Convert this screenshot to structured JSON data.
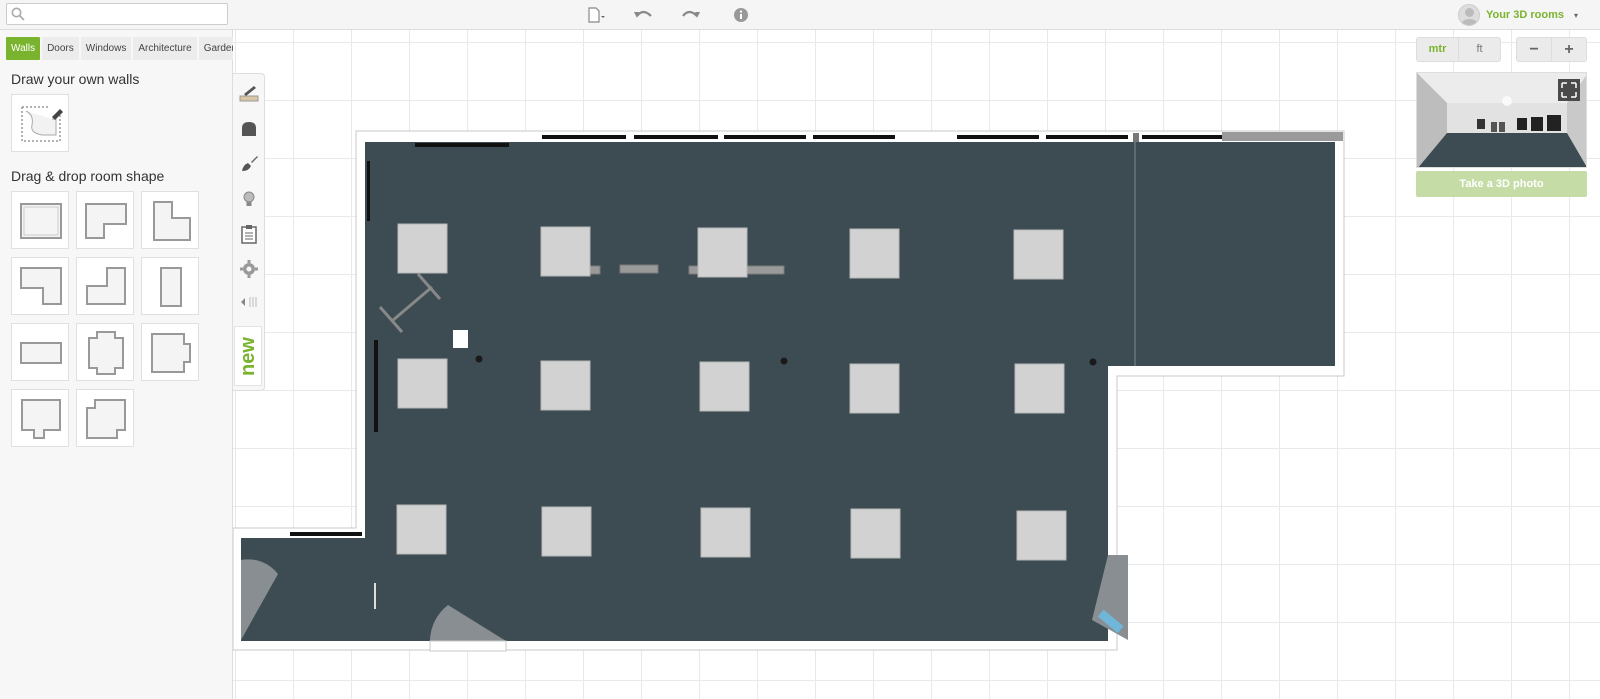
{
  "search": {
    "placeholder": ""
  },
  "toolbar": {
    "new_icon": "new-file-icon",
    "undo_icon": "undo-icon",
    "redo_icon": "redo-icon",
    "info_icon": "info-icon"
  },
  "user": {
    "label": "Your 3D rooms",
    "caret": "▾"
  },
  "left_tabs": [
    "Walls",
    "Doors",
    "Windows",
    "Architecture",
    "Garden"
  ],
  "active_tab": "Walls",
  "sections": {
    "draw_title": "Draw your own walls",
    "shapes_title": "Drag & drop room shape"
  },
  "room_shapes": [
    "square",
    "l-shape-top",
    "l-shape-step",
    "l-shape-bottom",
    "step-shape",
    "narrow-rectangle",
    "wide-rectangle",
    "cross-shape",
    "bay-shape",
    "notch-bottom",
    "notch-corners"
  ],
  "vertical_tools": [
    "walls-tool-icon",
    "furniture-icon",
    "paint-icon",
    "lighting-icon",
    "list-icon",
    "settings-icon",
    "collapse-icon"
  ],
  "new_badge": "new",
  "units": {
    "metric": "mtr",
    "imperial": "ft",
    "active": "mtr"
  },
  "zoom": {
    "out": "−",
    "in": "+"
  },
  "photo_button": "Take a 3D photo",
  "colors": {
    "accent": "#7ab32e",
    "floor": "#3d4c53",
    "furniture": "#d2d2d2",
    "wall": "#ffffff"
  }
}
